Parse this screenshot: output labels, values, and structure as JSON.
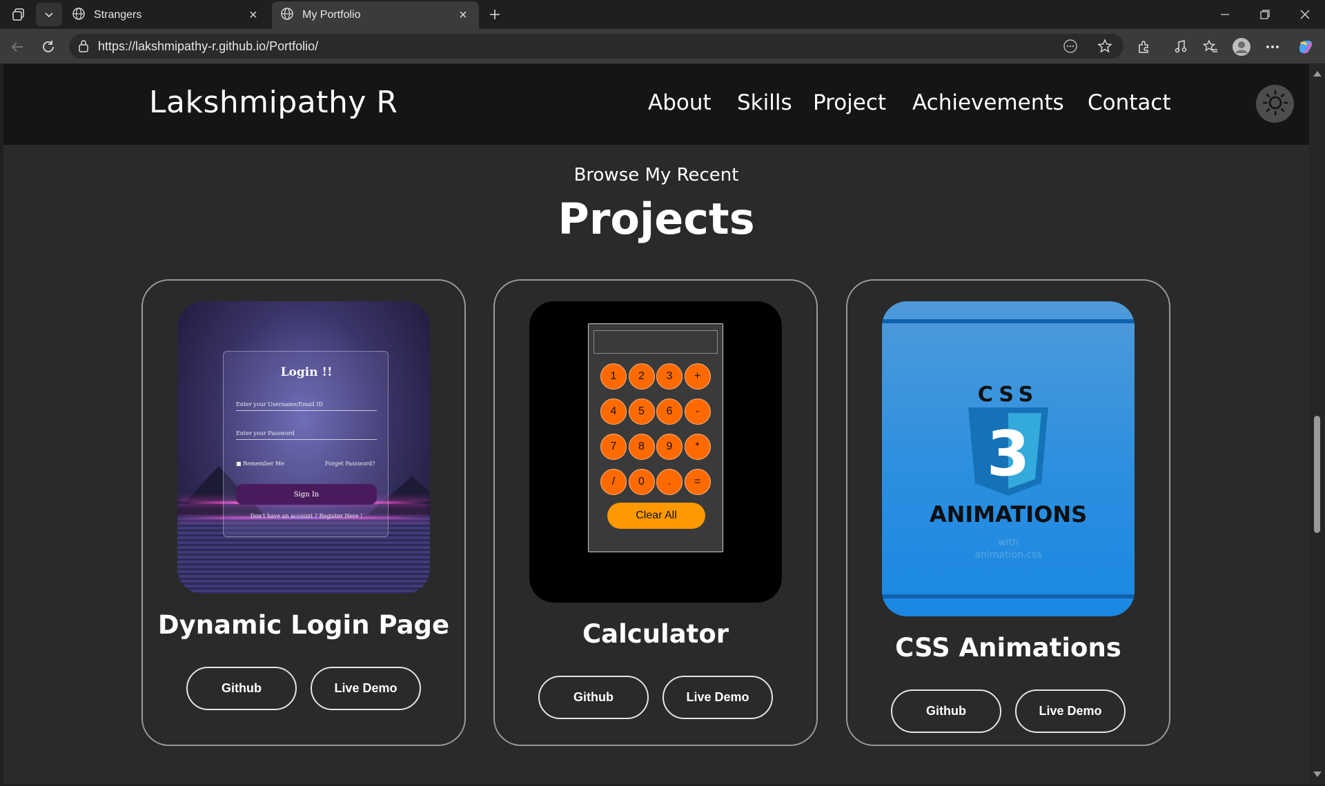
{
  "browser": {
    "tabs": [
      {
        "title": "Strangers",
        "active": false
      },
      {
        "title": "My Portfolio",
        "active": true
      }
    ],
    "url": "https://lakshmipathy-r.github.io/Portfolio/"
  },
  "header": {
    "logo": "Lakshmipathy R",
    "nav": [
      "About",
      "Skills",
      "Project",
      "Achievements",
      "Contact"
    ],
    "theme_icon": "sun-icon"
  },
  "section": {
    "subtitle": "Browse My Recent",
    "title": "Projects"
  },
  "projects": [
    {
      "title": "Dynamic Login Page",
      "github_label": "Github",
      "demo_label": "Live Demo",
      "thumbnail": {
        "heading": "Login !!",
        "user_placeholder": "Enter your Username/Email ID",
        "pass_placeholder": "Enter your Password",
        "remember": "Remember Me",
        "forgot": "Forget Password?",
        "sign_in": "Sign In",
        "register": "Don't have an account ? Register Here !"
      }
    },
    {
      "title": "Calculator",
      "github_label": "Github",
      "demo_label": "Live Demo",
      "thumbnail": {
        "keys": [
          "1",
          "2",
          "3",
          "+",
          "4",
          "5",
          "6",
          "-",
          "7",
          "8",
          "9",
          "*",
          "/",
          "0",
          ".",
          "="
        ],
        "clear": "Clear All"
      }
    },
    {
      "title": "CSS Animations",
      "github_label": "Github",
      "demo_label": "Live Demo",
      "thumbnail": {
        "css_text": "CSS",
        "number": "3",
        "word": "ANIMATIONS",
        "caption_line1": "with",
        "caption_line2": "animation.css"
      }
    }
  ],
  "colors": {
    "page_bg": "#2a2a2a",
    "header_bg": "#151515",
    "calc_key": "#ff6a00",
    "css_blue": "#1a88e2"
  }
}
